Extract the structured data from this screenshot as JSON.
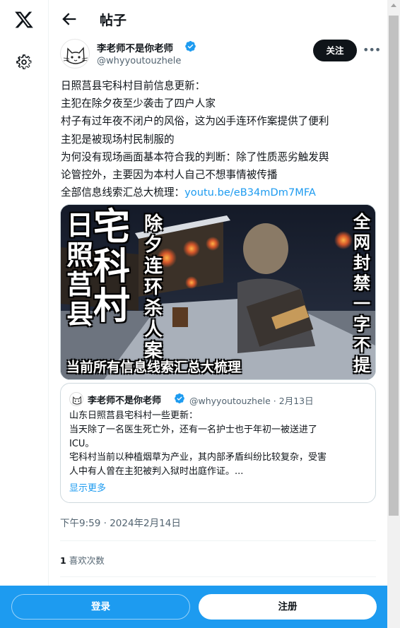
{
  "rail": {
    "logo_icon": "x-logo-icon",
    "settings_icon": "gear-icon"
  },
  "header": {
    "back_icon": "arrow-left-icon",
    "title": "帖子"
  },
  "post": {
    "author_name": "李老师不是你老师",
    "author_handle": "@whyyoutouzhele",
    "follow_label": "关注",
    "more_icon": "more-icon",
    "lines": [
      "日照莒县宅科村目前信息更新：",
      "主犯在除夕夜至少袭击了四户人家",
      "村子有过年夜不闭户的风俗，这为凶手连环作案提供了便利",
      "主犯是被现场村民制服的",
      "为何没有现场画面基本符合我的判断：除了性质恶劣触发舆",
      "论管控外，主要因为本村人自己不想事情被传播"
    ],
    "last_line_prefix": "全部信息线索汇总大梳理：",
    "link": "youtu.be/eB34mDm7MFA",
    "media_captions": {
      "left_small": "日照莒县",
      "left_big": "宅科村",
      "mid_vertical": "除夕连环杀人案",
      "right_vertical": "全网封禁一字不提",
      "bottom": "当前所有信息线索汇总大梳理"
    },
    "timestamp": "下午9:59 · 2024年2月14日",
    "likes_count": "1",
    "likes_label": "喜欢次数"
  },
  "quote": {
    "author_name": "李老师不是你老师",
    "handle_date": "@whyyoutouzhele · 2月13日",
    "lines": [
      "山东日照莒县宅科村一些更新：",
      "当天除了一名医生死亡外，还有一名护士也于年初一被送进了",
      "ICU。",
      "宅科村当前以种植烟草为产业，其内部矛盾纠纷比较复杂，受害",
      "人中有人曾在主犯被判入狱时出庭作证。..."
    ],
    "show_more": "显示更多"
  },
  "bottom_bar": {
    "login_label": "登录",
    "signup_label": "注册"
  },
  "colors": {
    "accent": "#1d9bf0",
    "text": "#0f1419",
    "muted": "#536471"
  }
}
